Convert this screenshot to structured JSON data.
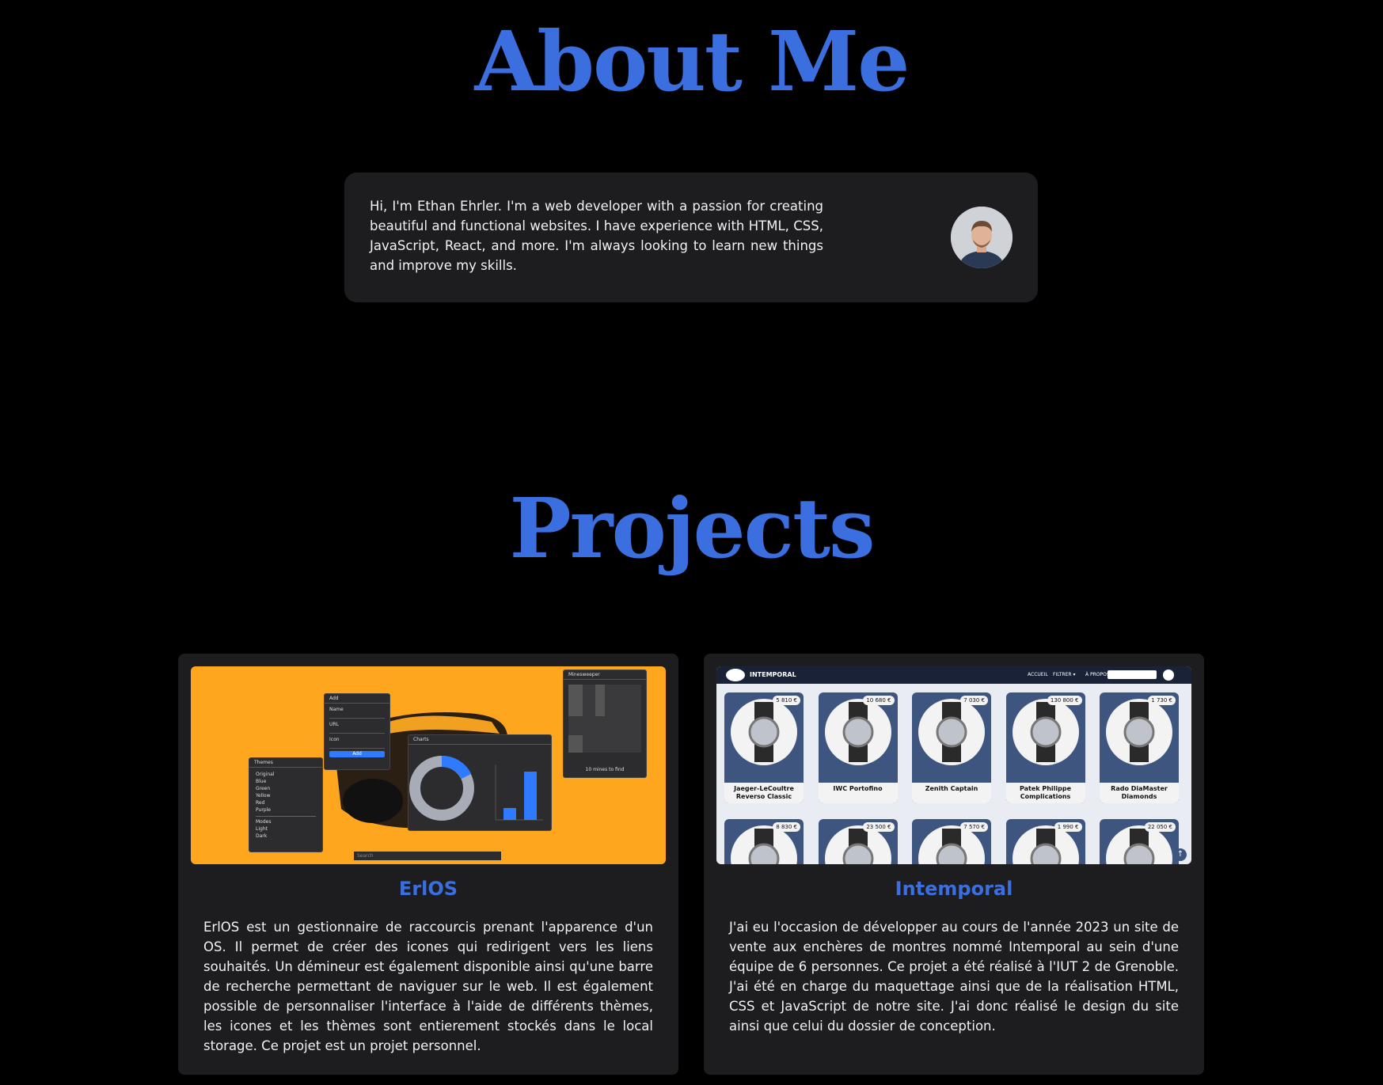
{
  "about": {
    "title": "About Me",
    "text": "Hi, I'm Ethan Ehrler. I'm a web developer with a passion for creating beautiful and functional websites. I have experience with HTML, CSS, JavaScript, React, and more. I'm always looking to learn new things and improve my skills."
  },
  "projects": {
    "title": "Projects",
    "items": [
      {
        "name": "ErlOS",
        "description": "ErlOS est un gestionnaire de raccourcis prenant l'apparence d'un OS. Il permet de créer des icones qui redirigent vers les liens souhaités. Un démineur est également disponible ainsi qu'une barre de recherche permettant de naviguer sur le web. Il est également possible de personnaliser l'interface à l'aide de différents thèmes, les icones et les thèmes sont entierement stockés dans le local storage. Ce projet est un projet personnel.",
        "screenshot": {
          "add_title": "Add",
          "add_fields": [
            "Name",
            "URL",
            "Icon"
          ],
          "add_button": "Add",
          "themes_title": "Themes",
          "themes": [
            "Original",
            "Blue",
            "Green",
            "Yellow",
            "Red",
            "Purple"
          ],
          "modes_title": "Modes",
          "modes": [
            "Light",
            "Dark"
          ],
          "charts_title": "Charts",
          "minesweeper_title": "Minesweeper",
          "mines_text": "10 mines to find",
          "search_placeholder": "Search"
        }
      },
      {
        "name": "Intemporal",
        "description": "J'ai eu l'occasion de développer au cours de l'année 2023 un site de vente aux enchères de montres nommé Intemporal au sein d'une équipe de 6 personnes. Ce projet a été réalisé à l'IUT 2 de Grenoble. J'ai été en charge du maquettage ainsi que de la réalisation HTML, CSS et JavaScript de notre site. J'ai donc réalisé le design du site ainsi que celui du dossier de conception.",
        "screenshot": {
          "brand": "INTEMPORAL",
          "nav": [
            "ACCUEIL",
            "FILTRER ▾",
            "À PROPOS"
          ],
          "watches": [
            {
              "price": "5 810 €",
              "name": "Jaeger-LeCoultre Reverso Classic"
            },
            {
              "price": "10 680 €",
              "name": "IWC Portofino"
            },
            {
              "price": "7 030 €",
              "name": "Zenith Captain"
            },
            {
              "price": "130 800 €",
              "name": "Patek Philippe Complications"
            },
            {
              "price": "1 730 €",
              "name": "Rado DiaMaster Diamonds"
            },
            {
              "price": "8 830 €",
              "name": ""
            },
            {
              "price": "23 500 €",
              "name": ""
            },
            {
              "price": "7 570 €",
              "name": ""
            },
            {
              "price": "1 990 €",
              "name": ""
            },
            {
              "price": "22 050 €",
              "name": ""
            }
          ]
        }
      }
    ]
  },
  "colors": {
    "accent": "#3b6fe0",
    "card": "#1d1d1f",
    "background": "#000000",
    "erlos_bg": "#fda61e"
  }
}
